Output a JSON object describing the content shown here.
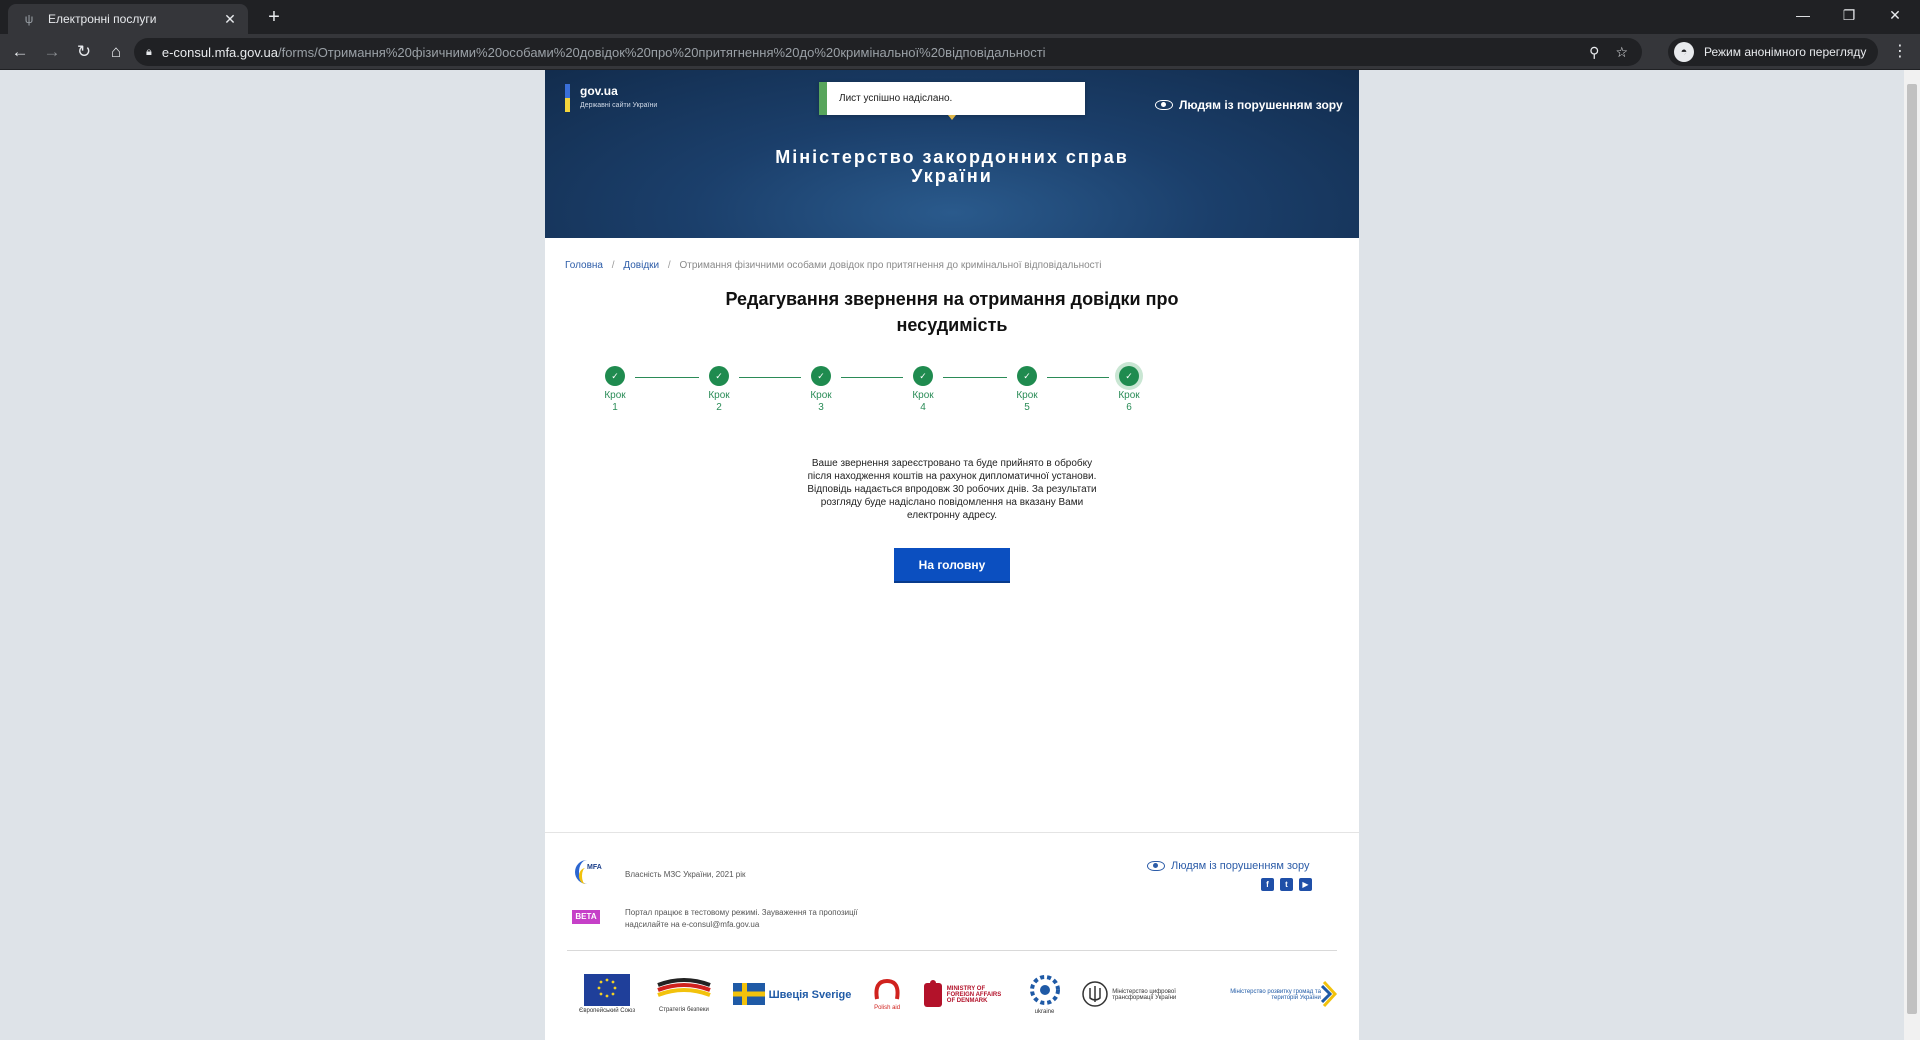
{
  "browser": {
    "tab_title": "Електронні послуги",
    "tab_favicon": "trident-icon",
    "url_host": "e-consul.mfa.gov.ua",
    "url_path": "/forms/Отримання%20фізичними%20особами%20довідок%20про%20притягнення%20до%20кримінальної%20відповідальності",
    "incognito_label": "Режим анонімного перегляду"
  },
  "header": {
    "gov_title": "gov.ua",
    "gov_subtitle": "Державні сайти України",
    "toast": "Лист успішно надіслано.",
    "accessibility": "Людям із порушенням зору",
    "ministry_line1": "Міністерство закордонних справ",
    "ministry_line2": "України"
  },
  "breadcrumbs": {
    "home": "Головна",
    "refs": "Довідки",
    "current": "Отримання фізичними особами довідок про притягнення до кримінальної відповідальності"
  },
  "form": {
    "title_line1": "Редагування звернення на отримання довідки про",
    "title_line2": "несудимість",
    "steps": [
      {
        "label": "Крок",
        "num": "1"
      },
      {
        "label": "Крок",
        "num": "2"
      },
      {
        "label": "Крок",
        "num": "3"
      },
      {
        "label": "Крок",
        "num": "4"
      },
      {
        "label": "Крок",
        "num": "5"
      },
      {
        "label": "Крок",
        "num": "6"
      }
    ],
    "message": "Ваше звернення зареєстровано та буде прийнято в обробку після находження коштів на рахунок дипломатичної установи. Відповідь надається впродовж 30 робочих днів. За результати розгляду буде надіслано повідомлення на вказану Вами електронну адресу.",
    "home_button": "На головну"
  },
  "footer": {
    "mfa_logo_text": "MFA",
    "property": "Власність МЗС України, 2021 рік",
    "accessibility": "Людям із порушенням зору",
    "beta_badge": "BETA",
    "beta_text": "Портал працює в тестовому режимі. Зауваження та пропозиції надсилайте на e-consul@mfa.gov.ua",
    "partners": [
      {
        "name": "Європейський Союз"
      },
      {
        "name": "Стратегія безпеки"
      },
      {
        "name": "Швеція Sverige"
      },
      {
        "name": "Polish aid"
      },
      {
        "name": "MINISTRY OF FOREIGN AFFAIRS OF DENMARK"
      },
      {
        "name": "ukraine"
      },
      {
        "name": "Міністерство цифрової трансформації України"
      },
      {
        "name": "Міністерство розвитку громад та територій України"
      }
    ]
  },
  "colors": {
    "hero": "#1b3f6b",
    "step_green": "#1f8b4f",
    "primary_button": "#0b4fc0",
    "beta": "#c640c8"
  }
}
